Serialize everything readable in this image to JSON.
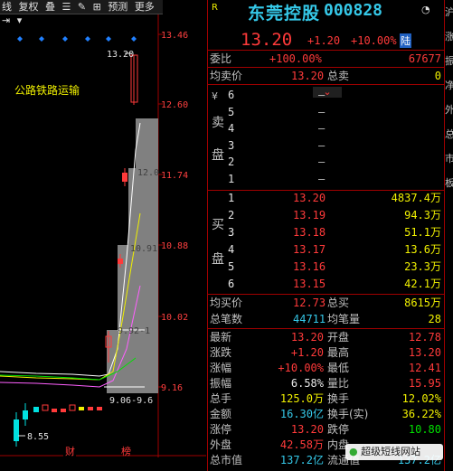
{
  "toolbar": {
    "items": [
      "线",
      "复权",
      "叠",
      "☰",
      "✎",
      "⊞",
      "预测",
      "更多",
      "⇥"
    ],
    "close": "▾"
  },
  "chart": {
    "price_ticks": [
      "13.46",
      "12.60",
      "11.74",
      "10.88",
      "10.02",
      "9.16"
    ],
    "annot_high": "13.20",
    "annot_low": "8.55",
    "annot_12": "12.0",
    "annot_1091": "10.91",
    "annot_992": "9.92-1",
    "annot_906": "9.06-9.6",
    "sector_label": "公路铁路运输",
    "markers": [
      "财",
      "榜"
    ],
    "colors": {
      "up": "#ff3a3a",
      "down": "#00e0e0",
      "ma5": "#ffffff",
      "ma10": "#f0f000",
      "ma20": "#ff60ff",
      "ma60": "#00e000"
    }
  },
  "stock": {
    "badge": "R",
    "name": "东莞控股",
    "code": "000828",
    "price": "13.20",
    "change": "+1.20",
    "pct": "+10.00%",
    "tag": "陆"
  },
  "weibi": {
    "label": "委比",
    "value": "+100.00%",
    "diff": "67677"
  },
  "avg_sell": {
    "label": "均卖价",
    "value": "13.20",
    "label2": "总卖",
    "value2": "0"
  },
  "sell_side": {
    "label": "卖盘",
    "levels": [
      "6",
      "5",
      "4",
      "3",
      "2",
      "1"
    ],
    "price": "—",
    "prefix": "¥"
  },
  "buy_side": {
    "label": "买盘",
    "levels": [
      {
        "n": "1",
        "price": "13.20",
        "vol": "4837.4万"
      },
      {
        "n": "2",
        "price": "13.19",
        "vol": "94.3万"
      },
      {
        "n": "3",
        "price": "13.18",
        "vol": "51.1万"
      },
      {
        "n": "4",
        "price": "13.17",
        "vol": "13.6万"
      },
      {
        "n": "5",
        "price": "13.16",
        "vol": "23.3万"
      },
      {
        "n": "6",
        "price": "13.15",
        "vol": "42.1万"
      }
    ]
  },
  "avg_buy": {
    "label": "均买价",
    "value": "12.73",
    "label2": "总买",
    "value2": "8615万"
  },
  "trades": {
    "label": "总笔数",
    "value": "44711",
    "label2": "均笔量",
    "value2": "28"
  },
  "stats": [
    {
      "l1": "最新",
      "v1": "13.20",
      "c1": "red",
      "l2": "开盘",
      "v2": "12.78",
      "c2": "red"
    },
    {
      "l1": "涨跌",
      "v1": "+1.20",
      "c1": "red",
      "l2": "最高",
      "v2": "13.20",
      "c2": "red"
    },
    {
      "l1": "涨幅",
      "v1": "+10.00%",
      "c1": "red",
      "l2": "最低",
      "v2": "12.41",
      "c2": "red"
    },
    {
      "l1": "振幅",
      "v1": "6.58%",
      "c1": "white",
      "l2": "量比",
      "v2": "15.95",
      "c2": "red"
    },
    {
      "l1": "总手",
      "v1": "125.0万",
      "c1": "yellow",
      "l2": "换手",
      "v2": "12.02%",
      "c2": "yellow"
    },
    {
      "l1": "金额",
      "v1": "16.30亿",
      "c1": "cyan",
      "l2": "换手(实)",
      "v2": "36.22%",
      "c2": "yellow"
    },
    {
      "l1": "涨停",
      "v1": "13.20",
      "c1": "red",
      "l2": "跌停",
      "v2": "10.80",
      "c2": "green"
    },
    {
      "l1": "外盘",
      "v1": "42.58万",
      "c1": "red",
      "l2": "内盘",
      "v2": "",
      "c2": "green"
    },
    {
      "l1": "总市值",
      "v1": "137.2亿",
      "c1": "cyan",
      "l2": "流通值",
      "v2": "137.2亿",
      "c2": "cyan"
    }
  ],
  "down_arrow": "⌄",
  "watermark": "超级短线网站",
  "side_strip": [
    "沪",
    "涨",
    "振",
    "净",
    "外",
    "总",
    "市",
    "板"
  ]
}
